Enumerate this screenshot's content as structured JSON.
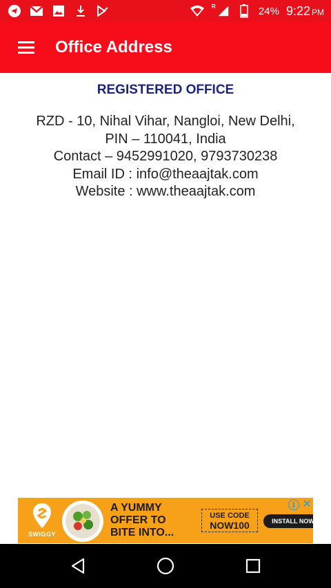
{
  "status_bar": {
    "left_icons": [
      "telegram-icon",
      "gmail-icon",
      "image-icon",
      "download-icon",
      "play-store-icon"
    ],
    "right_icons": [
      "wifi-icon",
      "signal-icon",
      "battery-icon"
    ],
    "network_label": "R",
    "battery_percent": "24%",
    "time": "9:22",
    "ampm": "PM",
    "color": "#e8111b"
  },
  "app_bar": {
    "title": "Office Address",
    "menu_icon": "hamburger-menu-icon",
    "color": "#f70d1a"
  },
  "content": {
    "heading": "REGISTERED OFFICE",
    "heading_color": "#1a237e",
    "lines": [
      "RZD - 10, Nihal Vihar, Nangloi, New Delhi,",
      "PIN – 110041, India",
      "Contact – 9452991020, 9793730238",
      "Email ID : info@theaajtak.com",
      "Website : www.theaajtak.com"
    ]
  },
  "ad": {
    "brand": "SWIGGY",
    "headline": [
      "A YUMMY",
      "OFFER TO",
      "BITE INTO..."
    ],
    "code_label": "USE CODE",
    "code_value": "NOW100",
    "cta": "INSTALL NOW",
    "background": "#f7a11a",
    "info_glyph": "i",
    "close_glyph": "✕"
  },
  "nav_bar": {
    "buttons": [
      "back-icon",
      "home-icon",
      "recents-icon"
    ]
  }
}
